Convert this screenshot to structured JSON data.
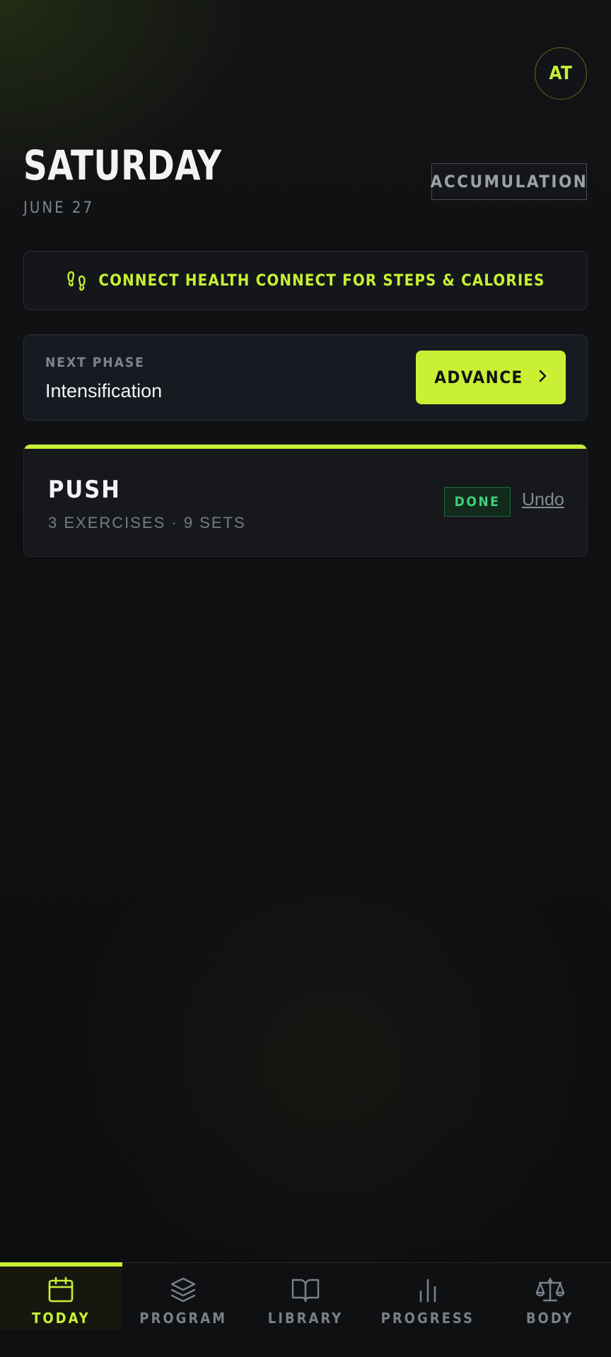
{
  "header": {
    "avatar_initials": "AT",
    "day": "SATURDAY",
    "date": "JUNE 27",
    "phase_badge": "ACCUMULATION"
  },
  "health": {
    "icon": "footprints-icon",
    "label": "CONNECT HEALTH CONNECT FOR STEPS & CALORIES"
  },
  "next_phase": {
    "label": "NEXT PHASE",
    "value": "Intensification",
    "button_label": "ADVANCE",
    "button_icon": "chevron-right-icon"
  },
  "workout": {
    "name": "PUSH",
    "meta": "3 EXERCISES · 9 SETS",
    "status": "DONE",
    "undo_label": "Undo"
  },
  "nav": {
    "items": [
      {
        "label": "TODAY",
        "icon": "calendar-icon",
        "active": true
      },
      {
        "label": "PROGRAM",
        "icon": "layers-icon",
        "active": false
      },
      {
        "label": "LIBRARY",
        "icon": "book-open-icon",
        "active": false
      },
      {
        "label": "PROGRESS",
        "icon": "bar-chart-icon",
        "active": false
      },
      {
        "label": "BODY",
        "icon": "scale-icon",
        "active": false
      }
    ]
  },
  "colors": {
    "accent": "#c9f034",
    "background": "#0e0f11",
    "done_green": "#3fd17b"
  }
}
